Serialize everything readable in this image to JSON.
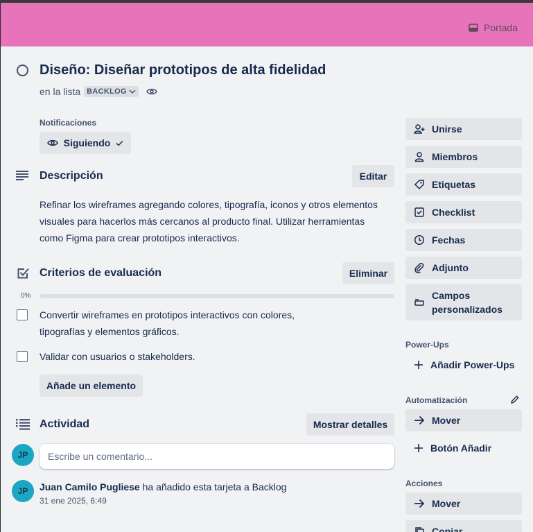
{
  "cover": {
    "button_label": "Portada",
    "color": "#e774bb"
  },
  "card": {
    "title": "Diseño: Diseñar prototipos de alta fidelidad",
    "in_list_prefix": "en la lista",
    "list_name": "BACKLOG"
  },
  "notifications": {
    "label": "Notificaciones",
    "button_label": "Siguiendo"
  },
  "description": {
    "title": "Descripción",
    "edit_label": "Editar",
    "text": "Refinar los wireframes agregando colores, tipografía, iconos y otros elementos visuales para hacerlos más cercanos al producto final. Utilizar herramientas como Figma para crear prototipos interactivos."
  },
  "checklist": {
    "title": "Criterios de evaluación",
    "delete_label": "Eliminar",
    "progress_text": "0%",
    "progress": 0,
    "items": [
      {
        "text": "Convertir wireframes en prototipos interactivos con colores, tipografías y elementos gráficos.",
        "checked": false
      },
      {
        "text": "Validar con usuarios o stakeholders.",
        "checked": false
      }
    ],
    "add_item_label": "Añade un elemento"
  },
  "activity": {
    "title": "Actividad",
    "show_details_label": "Mostrar detalles",
    "comment_placeholder": "Escribe un comentario...",
    "avatar_initials": "JP",
    "entries": [
      {
        "author": "Juan Camilo Pugliese",
        "action": " ha añadido esta tarjeta a Backlog",
        "timestamp": "31 ene 2025, 6:49"
      }
    ]
  },
  "sidebar": {
    "add_to_card": [
      {
        "label": "Unirse",
        "icon": "user-plus-icon"
      },
      {
        "label": "Miembros",
        "icon": "user-icon"
      },
      {
        "label": "Etiquetas",
        "icon": "tag-icon"
      },
      {
        "label": "Checklist",
        "icon": "checkbox-icon"
      },
      {
        "label": "Fechas",
        "icon": "clock-icon"
      },
      {
        "label": "Adjunto",
        "icon": "paperclip-icon"
      },
      {
        "label": "Campos personalizados",
        "line1": "Campos",
        "line2": "personalizados",
        "icon": "custom-fields-icon"
      }
    ],
    "powerups_label": "Power-Ups",
    "add_powerups_label": "Añadir Power-Ups",
    "automation_label": "Automatización",
    "automation_move_label": "Mover",
    "add_button_label": "Botón Añadir",
    "actions_label": "Acciones",
    "actions_move_label": "Mover",
    "actions_copy_label": "Copiar"
  }
}
